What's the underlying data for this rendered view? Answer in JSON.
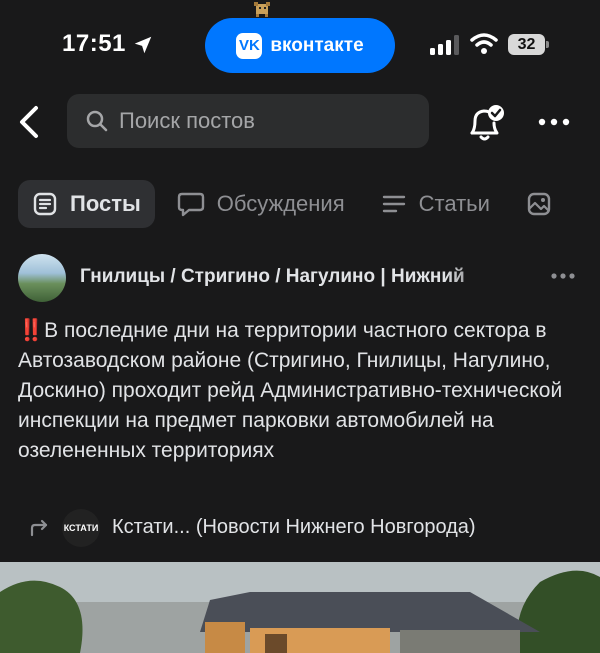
{
  "status_bar": {
    "time": "17:51",
    "battery": "32",
    "app_pill_label": "вконтакте",
    "app_pill_logo": "VK"
  },
  "header": {
    "search_placeholder": "Поиск постов"
  },
  "tabs": [
    {
      "label": "Посты",
      "icon": "posts-icon",
      "active": true
    },
    {
      "label": "Обсуждения",
      "icon": "discussions-icon",
      "active": false
    },
    {
      "label": "Статьи",
      "icon": "articles-icon",
      "active": false
    }
  ],
  "post": {
    "group_name": "Гнилицы / Стригино / Нагулино | Нижний",
    "alert_mark": "‼️",
    "text": "В последние дни на территории частного сектора в Автозаводском районе (Стригино, Гнилицы, Нагулино, Доскино) проходит рейд Административно-технической инспекции на предмет парковки автомобилей на озелененных территориях",
    "repost": {
      "avatar_text": "КСТАТИ",
      "source": "Кстати... (Новости Нижнего Новгорода)"
    }
  },
  "colors": {
    "background": "#19191a",
    "accent": "#0077ff",
    "alert": "#e0301e"
  }
}
